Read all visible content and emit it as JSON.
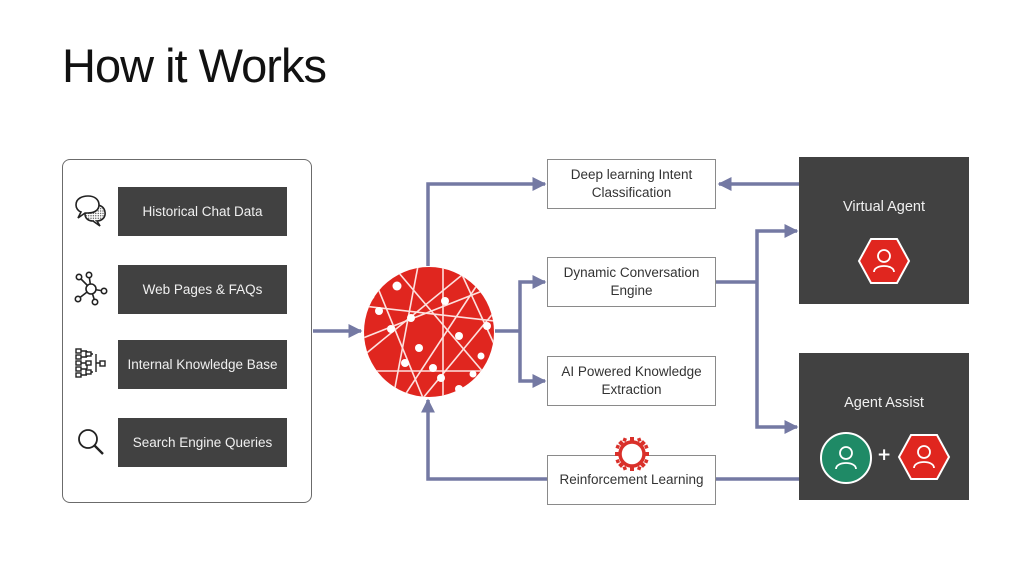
{
  "title": "How it Works",
  "sources": [
    {
      "label": "Historical Chat Data",
      "icon": "chat-bubbles-icon"
    },
    {
      "label": "Web Pages & FAQs",
      "icon": "network-nodes-icon"
    },
    {
      "label": "Internal Knowledge Base",
      "icon": "hierarchy-tree-icon"
    },
    {
      "label": "Search Engine Queries",
      "icon": "search-icon"
    }
  ],
  "hub": {
    "icon": "neural-network-sphere-icon"
  },
  "processes": [
    {
      "label": "Deep learning Intent Classification"
    },
    {
      "label": "Dynamic Conversation Engine"
    },
    {
      "label": "AI Powered Knowledge Extraction"
    },
    {
      "label": "Reinforcement Learning",
      "icon": "gear-icon"
    }
  ],
  "agents": [
    {
      "label": "Virtual Agent",
      "icons": [
        "bot-person-hexagon-icon"
      ]
    },
    {
      "label": "Agent Assist",
      "icons": [
        "human-person-circle-icon",
        "bot-person-hexagon-icon"
      ],
      "joiner": "+"
    }
  ],
  "colors": {
    "accent_red": "#e0261f",
    "human_green": "#1f8a66",
    "connector": "#7479a3",
    "dark_box": "#414141"
  }
}
